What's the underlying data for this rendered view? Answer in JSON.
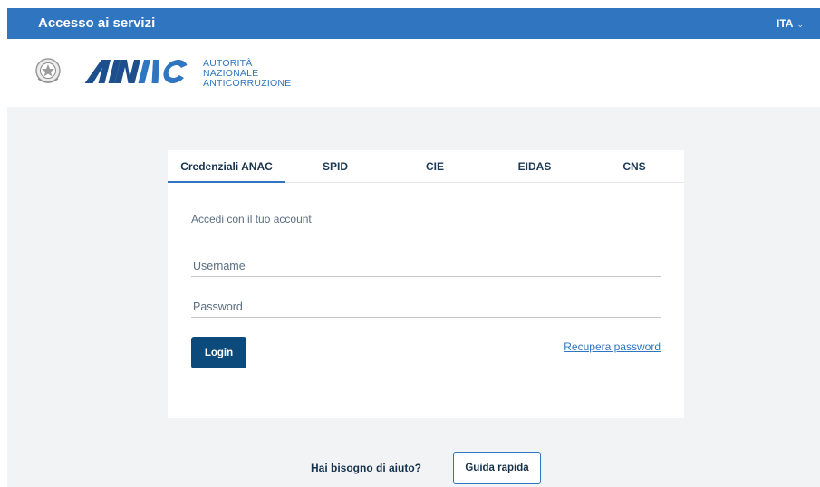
{
  "header": {
    "title": "Accesso ai servizi",
    "language": "ITA",
    "language_icon": "chevron-down-icon"
  },
  "brand": {
    "emblem_icon": "republic-emblem-icon",
    "logo_text": "ANAC",
    "agency_lines": [
      "AUTORITÀ",
      "NAZIONALE",
      "ANTICORRUZIONE"
    ]
  },
  "tabs": [
    {
      "label": "Credenziali ANAC",
      "active": true
    },
    {
      "label": "SPID",
      "active": false
    },
    {
      "label": "CIE",
      "active": false
    },
    {
      "label": "EIDAS",
      "active": false
    },
    {
      "label": "CNS",
      "active": false
    }
  ],
  "form": {
    "subtitle": "Accedi con il tuo account",
    "username_placeholder": "Username",
    "username_value": "",
    "password_placeholder": "Password",
    "password_value": "",
    "login_label": "Login",
    "recover_label": "Recupera password"
  },
  "help": {
    "question": "Hai bisogno di aiuto?",
    "guide_label": "Guida rapida"
  },
  "colors": {
    "header_bg": "#2f75c0",
    "primary_button": "#0b4a7a",
    "link": "#2f75c0",
    "page_bg": "#f2f3f5"
  }
}
